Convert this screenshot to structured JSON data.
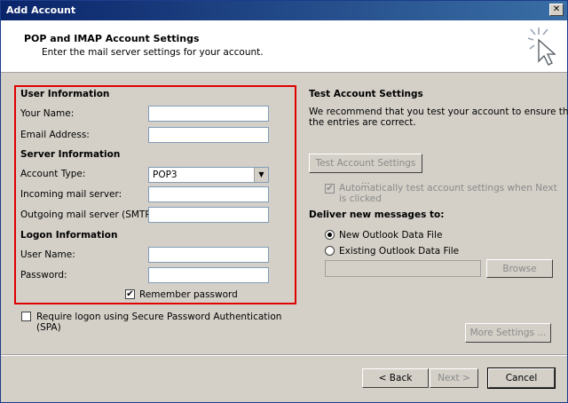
{
  "window": {
    "title": "Add Account",
    "close_glyph": "✕"
  },
  "header": {
    "title": "POP and IMAP Account Settings",
    "subtitle": "Enter the mail server settings for your account."
  },
  "user_info": {
    "heading": "User Information",
    "name_label": "Your Name:",
    "email_label": "Email Address:",
    "name_value": "",
    "email_value": ""
  },
  "server_info": {
    "heading": "Server Information",
    "account_type_label": "Account Type:",
    "account_type_value": "POP3",
    "incoming_label": "Incoming mail server:",
    "outgoing_label": "Outgoing mail server (SMTP):"
  },
  "logon_info": {
    "heading": "Logon Information",
    "username_label": "User Name:",
    "password_label": "Password:",
    "remember_label": "Remember password",
    "remember_checked": true
  },
  "spa": {
    "label_line1": "Require logon using Secure Password Authentication",
    "label_line2": "(SPA)",
    "checked": false
  },
  "test": {
    "heading": "Test Account Settings",
    "desc_line1": "We recommend that you test your account to ensure that",
    "desc_line2": "the entries are correct.",
    "button": "Test Account Settings ...",
    "auto_line1": "Automatically test account settings when Next",
    "auto_line2": "is clicked",
    "auto_checked": true
  },
  "deliver": {
    "heading": "Deliver new messages to:",
    "new_label": "New Outlook Data File",
    "existing_label": "Existing Outlook Data File",
    "browse": "Browse",
    "selected": "new"
  },
  "buttons": {
    "more": "More Settings ...",
    "back": "< Back",
    "next": "Next >",
    "cancel": "Cancel"
  },
  "icons": {
    "check": "✔",
    "dropdown": "▼"
  }
}
